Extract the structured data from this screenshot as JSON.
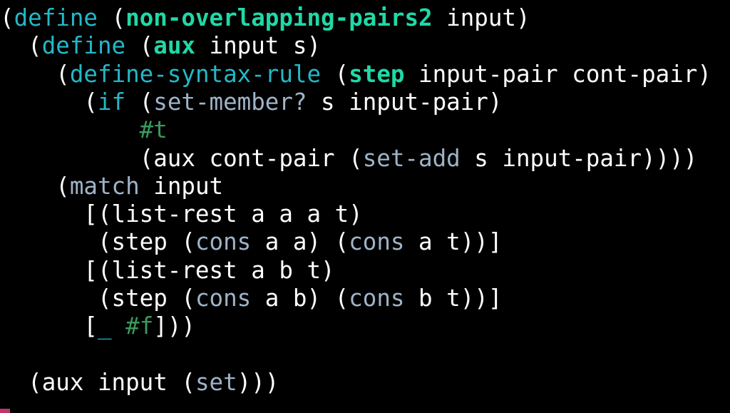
{
  "colors": {
    "background": "#000000",
    "keyword": "#23b8c8",
    "definition_name": "#1fd9a6",
    "builtin": "#9fb3c8",
    "literal": "#3a9a5c",
    "plain": "#ffffff",
    "margin_marker": "#c0356e"
  },
  "code": {
    "lines": [
      [
        {
          "t": "(",
          "c": "paren"
        },
        {
          "t": "define",
          "c": "kw"
        },
        {
          "t": " (",
          "c": "paren"
        },
        {
          "t": "non-overlapping-pairs2",
          "c": "defname"
        },
        {
          "t": " input)",
          "c": "plain"
        }
      ],
      [
        {
          "t": "  (",
          "c": "paren"
        },
        {
          "t": "define",
          "c": "kw"
        },
        {
          "t": " (",
          "c": "paren"
        },
        {
          "t": "aux",
          "c": "defname"
        },
        {
          "t": " input s)",
          "c": "plain"
        }
      ],
      [
        {
          "t": "    (",
          "c": "paren"
        },
        {
          "t": "define-syntax-rule",
          "c": "kw"
        },
        {
          "t": " (",
          "c": "paren"
        },
        {
          "t": "step",
          "c": "defname"
        },
        {
          "t": " input-pair cont-pair)",
          "c": "plain"
        }
      ],
      [
        {
          "t": "      (",
          "c": "paren"
        },
        {
          "t": "if",
          "c": "kw"
        },
        {
          "t": " (",
          "c": "paren"
        },
        {
          "t": "set-member?",
          "c": "builtin"
        },
        {
          "t": " s input-pair)",
          "c": "plain"
        }
      ],
      [
        {
          "t": "          ",
          "c": "plain"
        },
        {
          "t": "#t",
          "c": "lit"
        }
      ],
      [
        {
          "t": "          (aux cont-pair (",
          "c": "plain"
        },
        {
          "t": "set-add",
          "c": "builtin"
        },
        {
          "t": " s input-pair))))",
          "c": "plain"
        }
      ],
      [
        {
          "t": "    (",
          "c": "paren"
        },
        {
          "t": "match",
          "c": "builtin"
        },
        {
          "t": " input",
          "c": "plain"
        }
      ],
      [
        {
          "t": "      [(list-rest a a a t)",
          "c": "plain"
        }
      ],
      [
        {
          "t": "       (step (",
          "c": "plain"
        },
        {
          "t": "cons",
          "c": "builtin"
        },
        {
          "t": " a a) (",
          "c": "plain"
        },
        {
          "t": "cons",
          "c": "builtin"
        },
        {
          "t": " a t))]",
          "c": "plain"
        }
      ],
      [
        {
          "t": "      [(list-rest a b t)",
          "c": "plain"
        }
      ],
      [
        {
          "t": "       (step (",
          "c": "plain"
        },
        {
          "t": "cons",
          "c": "builtin"
        },
        {
          "t": " a b) (",
          "c": "plain"
        },
        {
          "t": "cons",
          "c": "builtin"
        },
        {
          "t": " b t))]",
          "c": "plain"
        }
      ],
      [
        {
          "t": "      [",
          "c": "plain"
        },
        {
          "t": "_",
          "c": "kw"
        },
        {
          "t": " ",
          "c": "plain"
        },
        {
          "t": "#f",
          "c": "lit"
        },
        {
          "t": "]))",
          "c": "plain"
        }
      ],
      [],
      [
        {
          "t": "  (aux input (",
          "c": "plain"
        },
        {
          "t": "set",
          "c": "builtin"
        },
        {
          "t": ")))",
          "c": "plain"
        }
      ]
    ]
  }
}
